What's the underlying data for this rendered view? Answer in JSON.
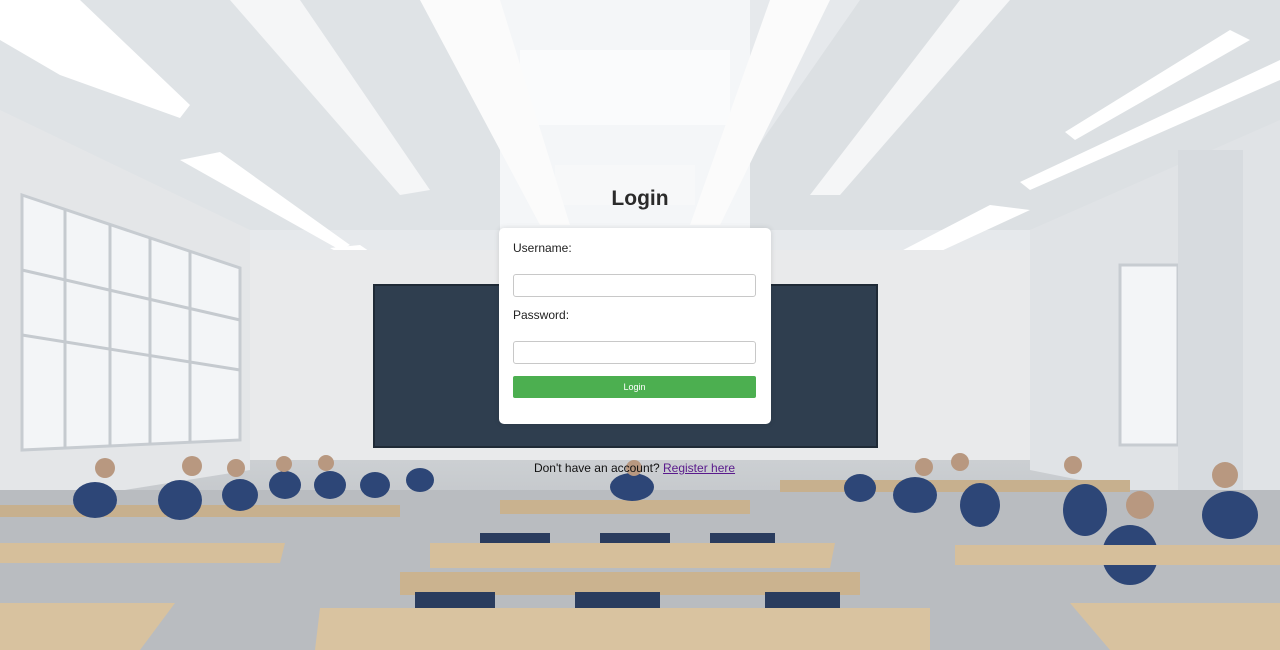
{
  "login": {
    "title": "Login",
    "username_label": "Username:",
    "username_value": "",
    "password_label": "Password:",
    "password_value": "",
    "submit_label": "Login"
  },
  "register": {
    "prompt": "Don't have an account?",
    "link_label": "Register here"
  },
  "colors": {
    "button": "#4caf50",
    "link": "#5a1a8c",
    "card": "#ffffff"
  }
}
